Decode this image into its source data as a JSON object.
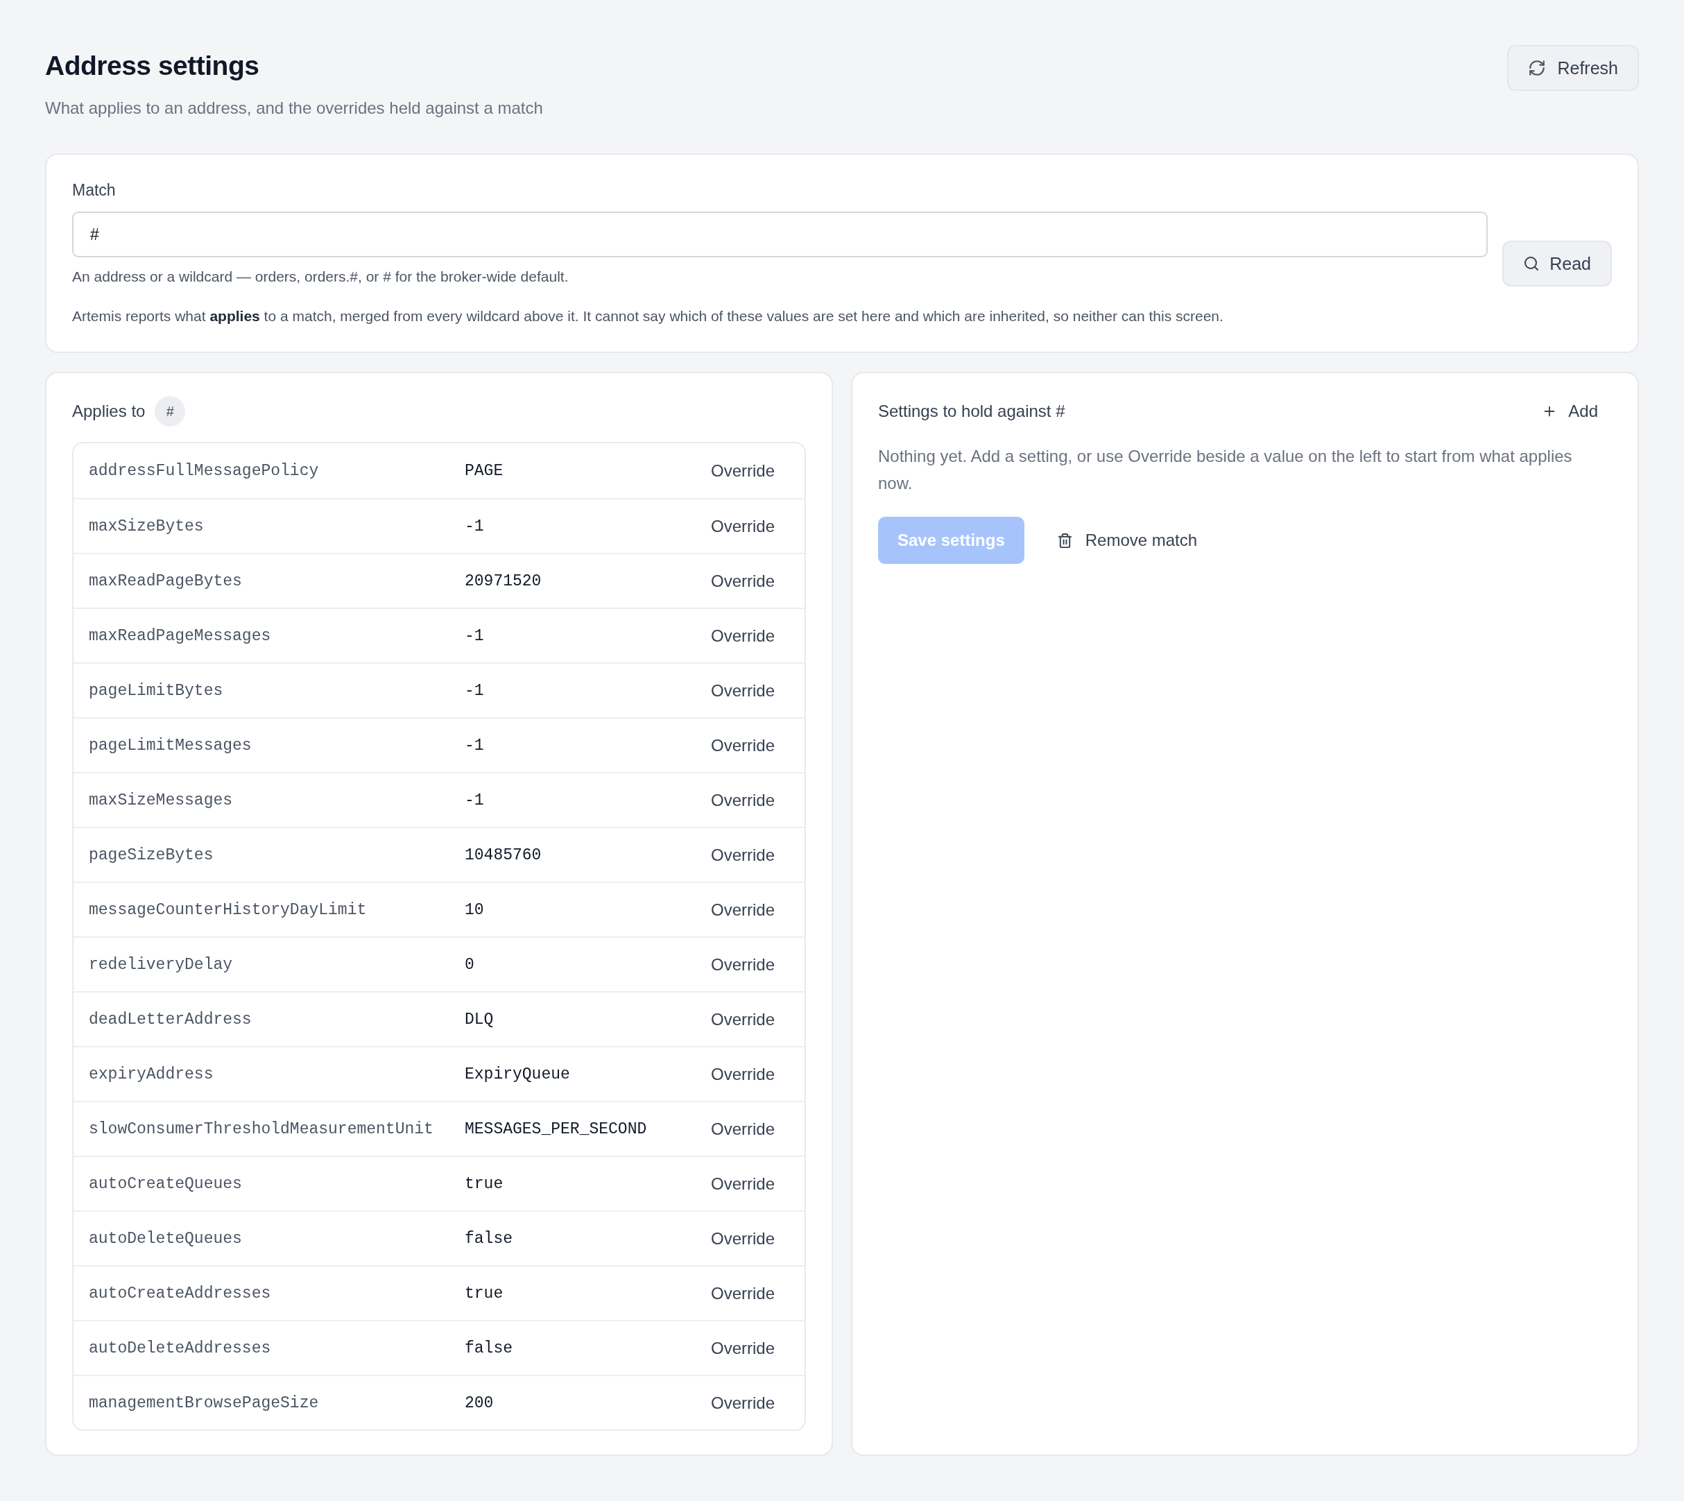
{
  "header": {
    "title": "Address settings",
    "subtitle": "What applies to an address, and the overrides held against a match",
    "refresh_button": "Refresh"
  },
  "match_card": {
    "label": "Match",
    "input": {
      "value": "#"
    },
    "hint": "An address or a wildcard — orders, orders.#, or # for the broker-wide default.",
    "read_button": "Read",
    "note": "Artemis reports what **applies** to a match, merged from every wildcard above it. It cannot say which of these values are set here and which are inherited, so neither can this screen."
  },
  "applies_panel": {
    "title": "Applies to",
    "badge": "#",
    "rows": [
      {
        "name": "addressFullMessagePolicy",
        "value": "PAGE",
        "action": "Override"
      },
      {
        "name": "maxSizeBytes",
        "value": "-1",
        "action": "Override"
      },
      {
        "name": "maxReadPageBytes",
        "value": "20971520",
        "action": "Override"
      },
      {
        "name": "maxReadPageMessages",
        "value": "-1",
        "action": "Override"
      },
      {
        "name": "pageLimitBytes",
        "value": "-1",
        "action": "Override"
      },
      {
        "name": "pageLimitMessages",
        "value": "-1",
        "action": "Override"
      },
      {
        "name": "maxSizeMessages",
        "value": "-1",
        "action": "Override"
      },
      {
        "name": "pageSizeBytes",
        "value": "10485760",
        "action": "Override"
      },
      {
        "name": "messageCounterHistoryDayLimit",
        "value": "10",
        "action": "Override"
      },
      {
        "name": "redeliveryDelay",
        "value": "0",
        "action": "Override"
      },
      {
        "name": "deadLetterAddress",
        "value": "DLQ",
        "action": "Override"
      },
      {
        "name": "expiryAddress",
        "value": "ExpiryQueue",
        "action": "Override"
      },
      {
        "name": "slowConsumerThresholdMeasurementUnit",
        "value": "MESSAGES_PER_SECOND",
        "action": "Override"
      },
      {
        "name": "autoCreateQueues",
        "value": "true",
        "action": "Override"
      },
      {
        "name": "autoDeleteQueues",
        "value": "false",
        "action": "Override"
      },
      {
        "name": "autoCreateAddresses",
        "value": "true",
        "action": "Override"
      },
      {
        "name": "autoDeleteAddresses",
        "value": "false",
        "action": "Override"
      },
      {
        "name": "managementBrowsePageSize",
        "value": "200",
        "action": "Override"
      }
    ]
  },
  "settings_panel": {
    "title": "Settings to hold against #",
    "add_button": "Add",
    "empty_text": "Nothing yet. Add a setting, or use Override beside a value on the left to start from what applies now.",
    "save_button": {
      "label": "Save settings",
      "disabled": true
    },
    "remove_button": "Remove match"
  }
}
